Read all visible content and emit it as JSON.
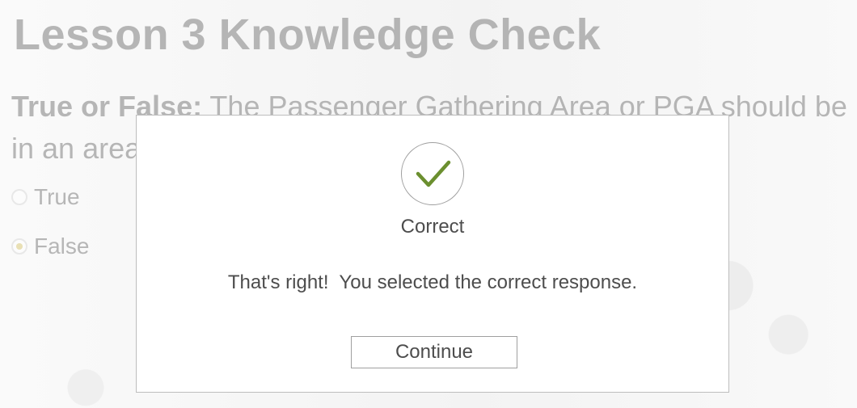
{
  "page": {
    "title": "Lesson 3 Knowledge Check",
    "question_prefix": "True or False:",
    "question_text": " The Passenger Gathering Area or PGA should be in an area",
    "options": [
      {
        "label": "True",
        "selected": false
      },
      {
        "label": "False",
        "selected": true
      }
    ]
  },
  "dialog": {
    "title": "Correct",
    "message": "That's right!  You selected the correct response.",
    "continue_label": "Continue",
    "icon": "checkmark-icon",
    "accent_color": "#6b8f2f"
  }
}
